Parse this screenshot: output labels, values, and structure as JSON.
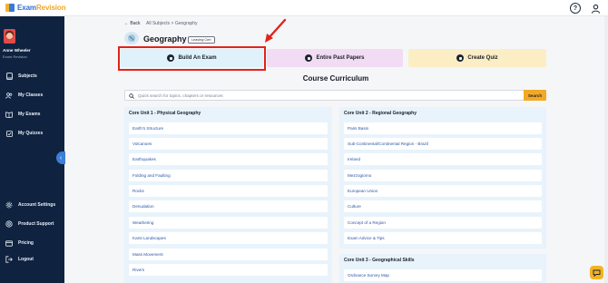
{
  "app": {
    "logo_brand": "Exam",
    "logo_suffix": "Revision",
    "help_label": "?"
  },
  "user": {
    "name": "Anne Wheeler",
    "role": "Exam Revision"
  },
  "sidebar": {
    "items": [
      {
        "label": "Subjects",
        "icon": "book-icon"
      },
      {
        "label": "My Classes",
        "icon": "people-icon"
      },
      {
        "label": "My Exams",
        "icon": "open-book-icon"
      },
      {
        "label": "My Quizzes",
        "icon": "checkbox-icon"
      },
      {
        "label": "Account Settings",
        "icon": "gear-icon"
      },
      {
        "label": "Product Support",
        "icon": "support-icon"
      },
      {
        "label": "Pricing",
        "icon": "card-icon"
      },
      {
        "label": "Logout",
        "icon": "logout-icon"
      }
    ],
    "collapse_glyph": "‹"
  },
  "breadcrumb": {
    "back": "← Back",
    "path": "All Subjects  >  Geography"
  },
  "subject": {
    "title": "Geography",
    "level": "Leaving Cert"
  },
  "actions": {
    "build": "Build An Exam",
    "past_papers": "Entire Past Papers",
    "quiz": "Create Quiz"
  },
  "curriculum": {
    "title": "Course Curriculum",
    "search_placeholder": "Quick search for topics, chapters or resources",
    "search_button": "Search"
  },
  "units": [
    {
      "title": "Core Unit 1 - Physical Geography",
      "topics": [
        "Earth's Structure",
        "Volcanoes",
        "Earthquakes",
        "Folding and Faulting",
        "Rocks",
        "Denudation",
        "Weathering",
        "Karst Landscapes",
        "Mass Movement",
        "Rivers"
      ]
    },
    {
      "title": "Core Unit 2 - Regional Geography",
      "topics": [
        "Paris Basin",
        "Sub-Continental/Continental Region - Brazil",
        "Ireland",
        "Mezzogiorno",
        "European Union",
        "Culture",
        "Concept of a Region",
        "Exam Advice & Tips"
      ]
    },
    {
      "title": "Core Unit 3 - Geographical Skills",
      "topics": [
        "Ordnance Survey Map"
      ]
    }
  ],
  "colors": {
    "sidebar_bg": "#0f2340",
    "highlight": "#e0241b",
    "search_accent": "#f3a925",
    "build_card": "#dff1fb",
    "past_card": "#f1dcf3",
    "quiz_card": "#fbeec4",
    "topic_link": "#2c56a8"
  }
}
